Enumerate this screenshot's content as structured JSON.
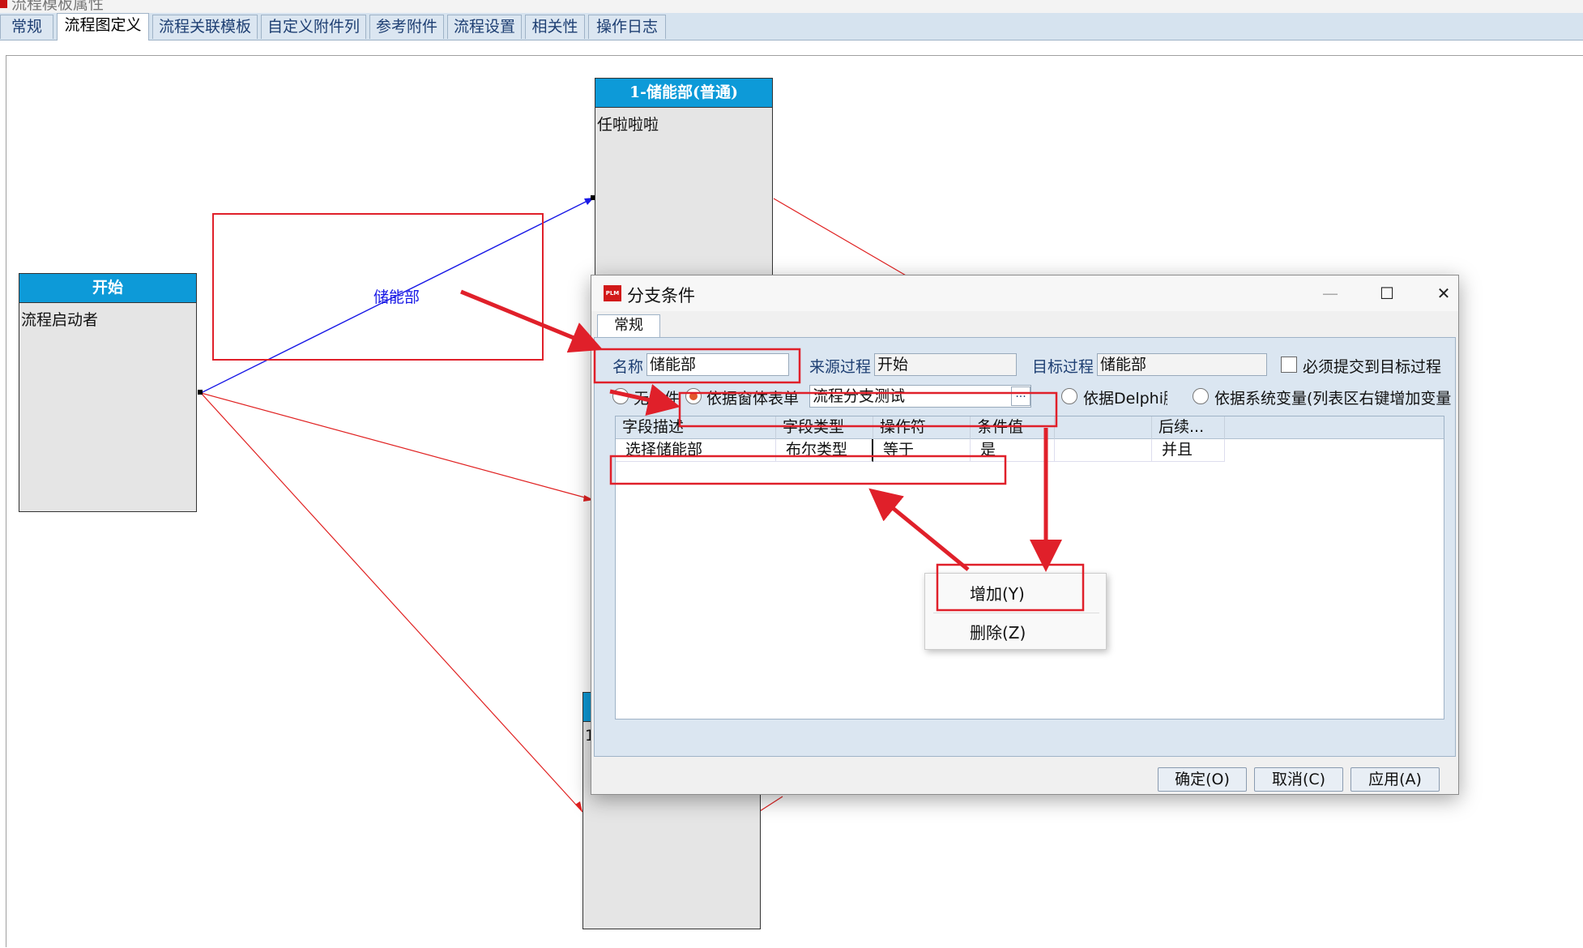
{
  "window": {
    "title": "流程模板属性"
  },
  "tabs": [
    "常规",
    "流程图定义",
    "流程关联模板",
    "自定义附件列",
    "参考附件",
    "流程设置",
    "相关性",
    "操作日志"
  ],
  "diagram": {
    "start_node": {
      "title": "开始",
      "body": "流程启动者"
    },
    "node1": {
      "title": "1-储能部(普通)",
      "body": "任啦啦啦"
    },
    "node3_body": "1",
    "edge_label": "储能部"
  },
  "dialog": {
    "title": "分支条件",
    "minimize": "—",
    "maximize": "☐",
    "close": "✕",
    "tab": "常规",
    "name_label": "名称",
    "name_value": "储能部",
    "source_label": "来源过程",
    "source_value": "开始",
    "target_label": "目标过程",
    "target_value": "储能部",
    "must_submit_label": "必须提交到目标过程",
    "opt_none": "无条件",
    "opt_form": "依据窗体表单",
    "form_value": "流程分支测试",
    "browse": "...",
    "opt_delphi": "依据Delphi脚本",
    "opt_sysvar": "依据系统变量(列表区右键增加变量)",
    "grid": {
      "headers": [
        "字段描述",
        "字段类型",
        "操作符",
        "条件值",
        "",
        "后续..."
      ],
      "rows": [
        [
          "选择储能部",
          "布尔类型",
          "等于",
          "是",
          "",
          "并且"
        ]
      ]
    },
    "ok": "确定(O)",
    "cancel": "取消(C)",
    "apply": "应用(A)"
  },
  "context_menu": {
    "add": "增加(Y)",
    "delete": "删除(Z)"
  },
  "colors": {
    "node_header": "#0d9ad8",
    "annotation": "#e0202a",
    "edge_blue": "#1a1ae6",
    "edge_red": "#e02020"
  }
}
